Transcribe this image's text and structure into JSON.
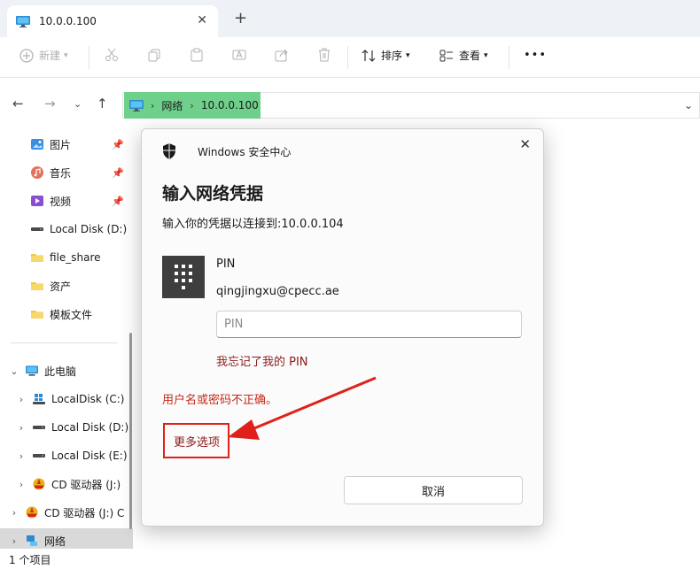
{
  "tab": {
    "title": "10.0.0.100",
    "close": "✕",
    "new_tab": "+"
  },
  "toolbar": {
    "new_label": "新建",
    "sort_label": "排序",
    "view_label": "查看",
    "more": "•••"
  },
  "address": {
    "crumbs": [
      "网络",
      "10.0.0.100"
    ]
  },
  "sidebar": {
    "pinned": [
      {
        "label": "图片",
        "icon": "pictures-icon"
      },
      {
        "label": "音乐",
        "icon": "music-icon"
      },
      {
        "label": "视频",
        "icon": "videos-icon"
      }
    ],
    "quick": [
      {
        "label": "Local Disk (D:)"
      },
      {
        "label": "file_share"
      },
      {
        "label": "资产"
      },
      {
        "label": "模板文件"
      }
    ],
    "this_pc": "此电脑",
    "drives": [
      {
        "label": "LocalDisk (C:)"
      },
      {
        "label": "Local Disk (D:)"
      },
      {
        "label": "Local Disk (E:)"
      },
      {
        "label": "CD 驱动器 (J:)"
      }
    ],
    "cd_root": "CD 驱动器 (J:) C",
    "network": "网络"
  },
  "status": {
    "count": "1 个项目"
  },
  "dialog": {
    "app_name": "Windows 安全中心",
    "heading": "输入网络凭据",
    "subtitle": "输入你的凭据以连接到:10.0.0.104",
    "pin_label": "PIN",
    "user": "qingjingxu@cpecc.ae",
    "pin_placeholder": "PIN",
    "forgot": "我忘记了我的 PIN",
    "error": "用户名或密码不正确。",
    "more_options": "更多选项",
    "cancel": "取消"
  },
  "colors": {
    "accent_green": "#6fd08c",
    "error_red": "#c42b1c",
    "annotation_red": "#e0201b"
  }
}
